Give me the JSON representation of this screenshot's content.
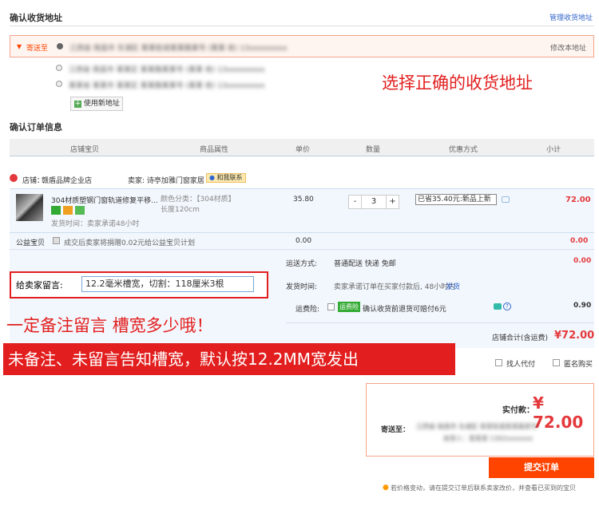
{
  "address": {
    "title": "确认收货地址",
    "manage_link": "管理收货地址",
    "send_to": "寄送至",
    "modify_link": "修改本地址",
    "items": [
      {
        "text": "江西省 南昌市 东湖区 某某街道某某路某号 (某某 收) 13xxxxxxxxx",
        "selected": true
      },
      {
        "text": "江西省 南昌市 某某区 某某路某某号 (某某 收) 13xxxxxxxxx",
        "selected": false
      },
      {
        "text": "某某省 某某市 某某区 某某路某某号 (某某 收) 13xxxxxxxxx",
        "selected": false
      }
    ],
    "use_new_label": "使用新地址",
    "hint": "选择正确的收货地址"
  },
  "order": {
    "title": "确认订单信息",
    "columns": [
      "店铺宝贝",
      "商品属性",
      "单价",
      "数量",
      "优惠方式",
      "小计"
    ],
    "shop_label": "店铺：",
    "shop_name": "赣盾品牌企业店",
    "seller_label": "卖家: 诗亭加雅门窗家居",
    "contact_label": "和我联系",
    "item": {
      "title": "304材质塑钢门窗轨道修复平移...",
      "ship_time": "发货时间：卖家承诺48小时",
      "attr": "颜色分类：【304材质】长度120cm",
      "price": "35.80",
      "quantity": "3",
      "minus": "-",
      "plus": "+",
      "discount": "已省35.40元:新品上新",
      "subtotal": "72.00"
    },
    "donate": {
      "label": "公益宝贝",
      "text": "成交后卖家将捐赠0.02元给公益宝贝计划",
      "price": "0.00",
      "subtotal": "0.00"
    },
    "shipping": {
      "label": "运送方式:",
      "value": "普通配送 快递 免邮",
      "cost": "0.00"
    },
    "delivery": {
      "label": "发货时间:",
      "value": "卖家承诺订单在买家付款后, 48小时内",
      "link": "发货"
    },
    "insurance": {
      "label": "运费险:",
      "badge": "运费险",
      "text": "确认收货前退货可赔付6元",
      "cost": "0.90"
    },
    "shop_total": {
      "label": "店铺合计(含运费)",
      "value": "¥72.00"
    },
    "message": {
      "label": "给卖家留言:",
      "value": "12.2毫米槽宽，切割：118厘米3根"
    },
    "note_hint": "一定备注留言 槽宽多少哦！",
    "warning": "未备注、未留言告知槽宽，默认按12.2MM宽发出",
    "proxy_pay": "找人代付",
    "anonymous": "匿名购买"
  },
  "payment": {
    "actual_label": "实付款：",
    "amount": "¥ 72.00",
    "send_to_label": "寄送至：",
    "address": "江西省 南昌市 东湖区 某某街道某某路某号",
    "receiver": "收货人：某某某 1302xxxxxxx",
    "submit": "提交订单",
    "notice": "若价格变动，请在提交订单后联系卖家改价，并查看已买到的宝贝"
  },
  "colors": {
    "accent": "#ff4400",
    "price": "#e4393c",
    "annotation": "#e21e1e",
    "link": "#3366cc"
  }
}
